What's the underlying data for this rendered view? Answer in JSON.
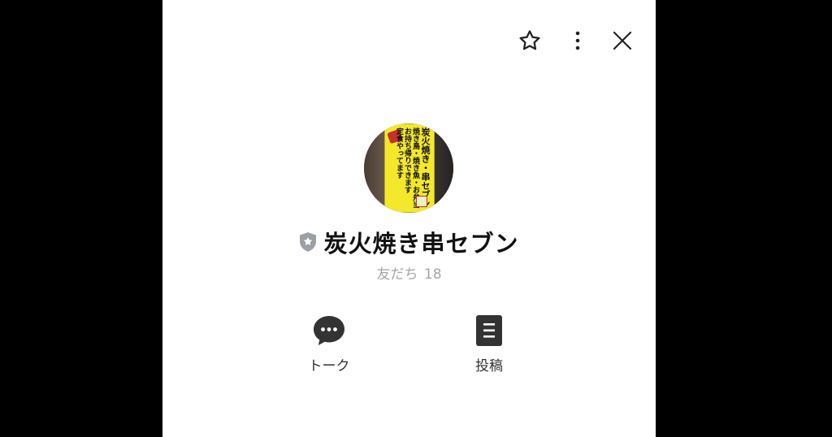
{
  "profile": {
    "name": "炭火焼き串セブン",
    "friends_label": "友だち",
    "friends_count": "18",
    "avatar_sign": {
      "col1": "炭火焼き・串セブン",
      "col2": "焼き鳥・焼き魚・お弁当",
      "col3": "お持ち帰りできます",
      "col4": "定食やってます",
      "col5": ""
    }
  },
  "actions": [
    {
      "label": "トーク",
      "icon": "chat-bubble-icon"
    },
    {
      "label": "投稿",
      "icon": "document-icon"
    }
  ],
  "topbar": {
    "icons": [
      "star-icon",
      "more-vertical-icon",
      "close-icon"
    ]
  },
  "colors": {
    "background": "#000000",
    "panel": "#ffffff",
    "text": "#111111",
    "muted": "#a5a5a5",
    "icon": "#333333"
  }
}
